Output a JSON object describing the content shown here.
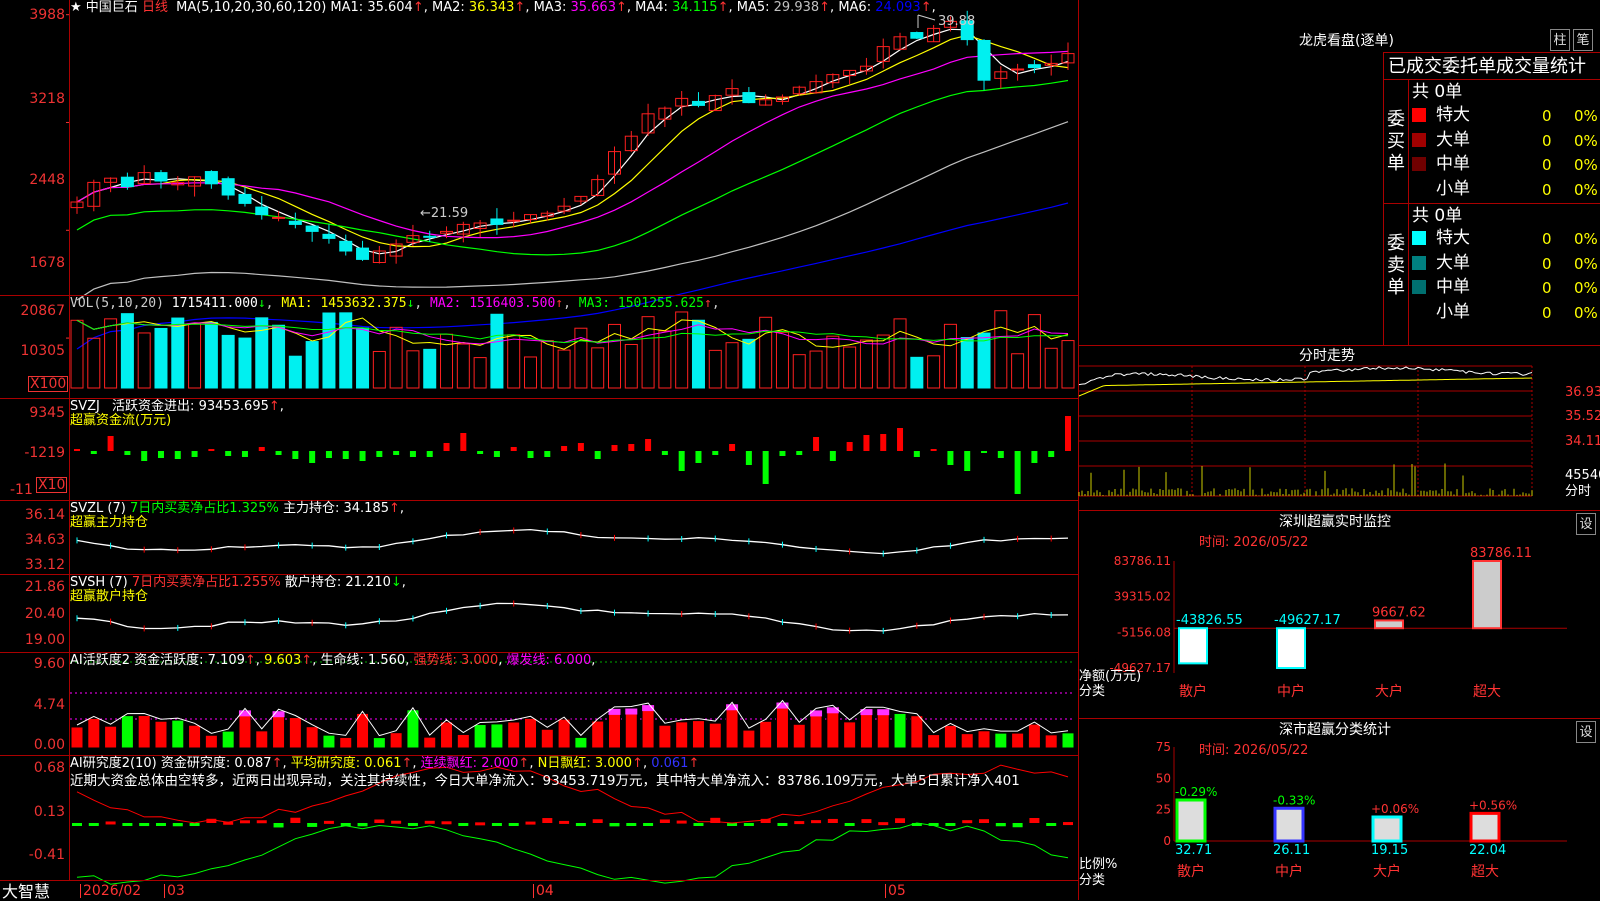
{
  "colors": {
    "up": "#ff2020",
    "down": "#00f0f0",
    "grid": "#a00000",
    "bg": "#000000"
  },
  "k_panel": {
    "title": "中国巨石",
    "period": "日线",
    "ma_params": "MA(5,10,20,30,60,120)",
    "ma": [
      {
        "label": "MA1:",
        "value": "35.604",
        "arrow": "↑",
        "color": "#ffffff"
      },
      {
        "label": "MA2:",
        "value": "36.343",
        "arrow": "↑",
        "color": "#ffff00"
      },
      {
        "label": "MA3:",
        "value": "35.663",
        "arrow": "↑",
        "color": "#ff00ff"
      },
      {
        "label": "MA4:",
        "value": "34.115",
        "arrow": "↑",
        "color": "#00ff00"
      },
      {
        "label": "MA5:",
        "value": "29.938",
        "arrow": "↑",
        "color": "#c0c0c0"
      },
      {
        "label": "MA6:",
        "value": "24.093",
        "arrow": "↑",
        "color": "#0000ff"
      }
    ],
    "axis": [
      "3988",
      "3218",
      "2448",
      "1678"
    ],
    "high_label": "39.88",
    "low_label": "21.59"
  },
  "vol_panel": {
    "title": "VOL(5,10,20)",
    "value": "1715411.000",
    "value_arrow": "↓",
    "ma": [
      {
        "label": "MA1:",
        "value": "1453632.375",
        "arrow": "↓",
        "color": "#ffff00"
      },
      {
        "label": "MA2:",
        "value": "1516403.500",
        "arrow": "↑",
        "color": "#ff00ff"
      },
      {
        "label": "MA3:",
        "value": "1501255.625",
        "arrow": "↑",
        "color": "#00ff00"
      }
    ],
    "axis": [
      "20867",
      "10305"
    ],
    "unit": "X100"
  },
  "svzj_panel": {
    "title": "SVZJ",
    "label": "活跃资金进出:",
    "value": "93453.695",
    "arrow": "↑",
    "sub": "超赢资金流(万元)",
    "axis": [
      "9345",
      "-1219",
      "-11"
    ],
    "unit": "X10"
  },
  "svzl_panel": {
    "title": "SVZL (7)",
    "green_text": "7日内买卖净占比1.325%",
    "label": "主力持仓:",
    "value": "34.185",
    "arrow": "↑",
    "sub": "超赢主力持仓",
    "axis": [
      "36.14",
      "34.63",
      "33.12"
    ]
  },
  "svsh_panel": {
    "title": "SVSH (7)",
    "red_text": "7日内买卖净占比1.255%",
    "label": "散户持仓:",
    "value": "21.210",
    "arrow": "↓",
    "sub": "超赢散户持仓",
    "axis": [
      "21.86",
      "20.40",
      "19.00"
    ]
  },
  "ai_active_panel": {
    "title": "AI活跃度2",
    "label": "资金活跃度:",
    "value": "7.109",
    "value2": "9.603",
    "life_label": "生命线:",
    "life_value": "1.560",
    "strong_label": "强势线:",
    "strong_value": "3.000",
    "burst_label": "爆发线:",
    "burst_value": "6.000",
    "axis": [
      "9.60",
      "4.74",
      "0.00"
    ]
  },
  "ai_research_panel": {
    "title": "AI研究度2(10)",
    "label": "资金研究度:",
    "value": "0.087",
    "avg_label": "平均研究度:",
    "avg_value": "0.061",
    "cont_label": "连续飘红:",
    "cont_value": "2.000",
    "n_label": "N日飘红:",
    "n_value": "3.000",
    "last_value": "0.061",
    "comment": "近期大资金总体由空转多，近两日出现异动，关注其持续性，今日大单净流入：93453.719万元，其中特大单净流入：83786.109万元，大单5日累计净入401",
    "axis": [
      "0.68",
      "0.13",
      "-0.41"
    ]
  },
  "date_axis": {
    "year": "2026/02",
    "months": [
      "03",
      "04",
      "05"
    ]
  },
  "bottom_left": "大智慧",
  "right": {
    "lhb_title": "龙虎看盘(逐单)",
    "btn_bar": "柱",
    "btn_pen": "笔",
    "stat_header": "已成交委托单成交量统计",
    "buy_label": "委买单",
    "sell_label": "委卖单",
    "buy_total": "共 0单",
    "sell_total": "共 0单",
    "buy_rows": [
      {
        "name": "特大",
        "count": "0",
        "pct": "0%",
        "color": "#ff0000"
      },
      {
        "name": "大单",
        "count": "0",
        "pct": "0%",
        "color": "#a00000"
      },
      {
        "name": "中单",
        "count": "0",
        "pct": "0%",
        "color": "#700000"
      },
      {
        "name": "小单",
        "count": "0",
        "pct": "0%",
        "color": "#000000"
      }
    ],
    "sell_rows": [
      {
        "name": "特大",
        "count": "0",
        "pct": "0%",
        "color": "#00ffff"
      },
      {
        "name": "大单",
        "count": "0",
        "pct": "0%",
        "color": "#008080"
      },
      {
        "name": "中单",
        "count": "0",
        "pct": "0%",
        "color": "#007070"
      },
      {
        "name": "小单",
        "count": "0",
        "pct": "0%",
        "color": "#000000"
      }
    ],
    "fs_title": "分时走势",
    "fs_axis": [
      "36.93",
      "35.52",
      "34.11",
      "45540"
    ],
    "fs_unit": "分时",
    "sz_title": "深圳超赢实时监控",
    "sz_set": "设",
    "sz_date": "时间: 2026/05/22",
    "sz_axis": [
      "83786.11",
      "39315.02",
      "-5156.08",
      "-49627.17"
    ],
    "sz_ylabel": "净额(万元)",
    "sz_xlabel": "分类",
    "sz_values": [
      {
        "label": "-43826.55",
        "value": -43826.55
      },
      {
        "label": "-49627.17",
        "value": -49627.17
      },
      {
        "label": "9667.62",
        "value": 9667.62
      },
      {
        "label": "83786.11",
        "value": 83786.11
      }
    ],
    "sz_cats": [
      "散户",
      "中户",
      "大户",
      "超大"
    ],
    "fl_title": "深市超赢分类统计",
    "fl_set": "设",
    "fl_date": "时间: 2026/05/22",
    "fl_axis": [
      "75",
      "50",
      "25",
      "0"
    ],
    "fl_ylabel": "比例%",
    "fl_xlabel": "分类",
    "fl_pct": [
      "-0.29%",
      "-0.33%",
      "+0.06%",
      "+0.56%"
    ],
    "fl_values": [
      "32.71",
      "26.11",
      "19.15",
      "22.04"
    ],
    "fl_cats": [
      "散户",
      "中户",
      "大户",
      "超大"
    ]
  }
}
